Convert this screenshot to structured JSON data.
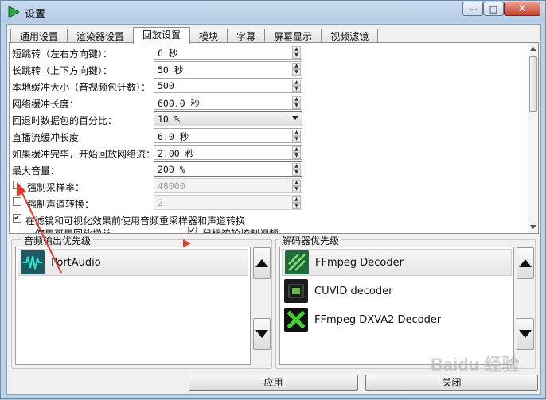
{
  "window": {
    "title": "设置",
    "controls": {
      "minimize": "—",
      "maximize": "□",
      "close": "✕"
    }
  },
  "tabs": [
    {
      "label": "通用设置",
      "active": false
    },
    {
      "label": "渲染器设置",
      "active": false
    },
    {
      "label": "回放设置",
      "active": true
    },
    {
      "label": "模块",
      "active": false
    },
    {
      "label": "字幕",
      "active": false
    },
    {
      "label": "屏幕显示",
      "active": false
    },
    {
      "label": "视频滤镜",
      "active": false
    }
  ],
  "settings": {
    "short_jump": {
      "label": "短跳转（左右方向键）：",
      "value": "6 秒"
    },
    "long_jump": {
      "label": "长跳转（上下方向键）：",
      "value": "50 秒"
    },
    "local_buffer": {
      "label": "本地缓冲大小（音视频包计数）：",
      "value": "500"
    },
    "net_buffer": {
      "label": "网络缓冲长度：",
      "value": "600.0 秒"
    },
    "rewind_percent": {
      "label": "回退时数据包的百分比：",
      "value": "10 %"
    },
    "live_buffer": {
      "label": "直播流缓冲长度",
      "value": "6.0 秒"
    },
    "resume_after": {
      "label": "如果缓冲完毕，开始回放网络流：",
      "value": "2.00 秒"
    },
    "max_volume": {
      "label": "最大音量：",
      "value": "200 %"
    },
    "force_samplerate": {
      "label": "强制采样率：",
      "value": "48000",
      "checked": false
    },
    "force_channels": {
      "label": "强制声道转换：",
      "value": "2",
      "checked": false
    },
    "resample_before_filters": {
      "label": "在滤镜和可视化效果前使用音频重采样器和声道转换",
      "checked": true
    },
    "replay_gain": {
      "label": "使用可用回放增益",
      "checked": false
    },
    "wheel_volume": {
      "label": "鼠标滚轮控制视频",
      "checked": true
    }
  },
  "audio_output": {
    "title": "音频输出优先级",
    "items": [
      {
        "label": "PortAudio",
        "icon": "portaudio-icon",
        "selected": true
      }
    ]
  },
  "decoders": {
    "title": "解码器优先级",
    "items": [
      {
        "label": "FFmpeg Decoder",
        "icon": "ffmpeg-icon",
        "selected": true
      },
      {
        "label": "CUVID decoder",
        "icon": "cuvid-icon",
        "selected": false
      },
      {
        "label": "FFmpeg DXVA2 Decoder",
        "icon": "dxva2-icon",
        "selected": false
      }
    ]
  },
  "buttons": {
    "apply": "应用",
    "close": "关闭"
  },
  "watermark": "Baidu 经验",
  "colors": {
    "accent_green": "#2ca84b",
    "annotation_red": "#e23b2e"
  }
}
